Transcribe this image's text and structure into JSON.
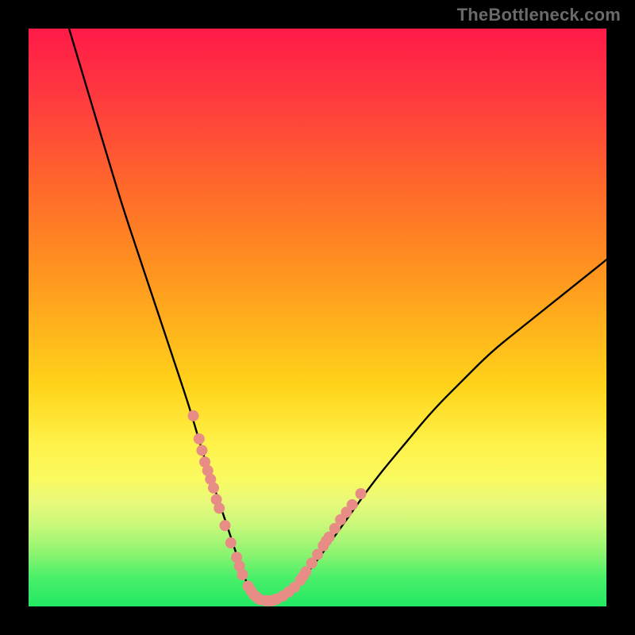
{
  "watermark": "TheBottleneck.com",
  "chart_data": {
    "type": "line",
    "title": "",
    "xlabel": "",
    "ylabel": "",
    "xlim": [
      0,
      100
    ],
    "ylim": [
      0,
      100
    ],
    "grid": false,
    "legend": false,
    "background_gradient": {
      "direction": "top-to-bottom",
      "stops": [
        {
          "pos": 0,
          "color": "#ff1a48"
        },
        {
          "pos": 12,
          "color": "#ff3a3f"
        },
        {
          "pos": 28,
          "color": "#ff6a2a"
        },
        {
          "pos": 44,
          "color": "#ff9a1e"
        },
        {
          "pos": 62,
          "color": "#ffd41a"
        },
        {
          "pos": 72,
          "color": "#fff24a"
        },
        {
          "pos": 78,
          "color": "#f9fa60"
        },
        {
          "pos": 82,
          "color": "#e8f97a"
        },
        {
          "pos": 86,
          "color": "#c8f879"
        },
        {
          "pos": 91,
          "color": "#8af470"
        },
        {
          "pos": 95,
          "color": "#4aef6a"
        },
        {
          "pos": 100,
          "color": "#22e863"
        }
      ]
    },
    "series": [
      {
        "name": "bottleneck-curve",
        "color": "#000000",
        "x": [
          7,
          10,
          13,
          16,
          19,
          22,
          25,
          28,
          30,
          32,
          34,
          35,
          36,
          37,
          38,
          39,
          40,
          42,
          44,
          46,
          50,
          55,
          60,
          65,
          70,
          75,
          80,
          85,
          90,
          95,
          100
        ],
        "y": [
          100,
          90,
          80,
          70,
          61,
          52,
          43,
          34,
          27,
          21,
          15,
          12,
          9,
          6,
          3.5,
          2,
          1.2,
          1,
          1.5,
          3,
          8,
          15,
          22,
          28,
          34,
          39,
          44,
          48,
          52,
          56,
          60
        ]
      }
    ],
    "points": {
      "name": "sample-dots",
      "color": "#e88d86",
      "radius_px": 7,
      "data": [
        {
          "x": 28.5,
          "y": 33
        },
        {
          "x": 29.5,
          "y": 29
        },
        {
          "x": 30,
          "y": 27
        },
        {
          "x": 30.5,
          "y": 25
        },
        {
          "x": 31,
          "y": 23.5
        },
        {
          "x": 31.5,
          "y": 22
        },
        {
          "x": 32,
          "y": 20.5
        },
        {
          "x": 32.5,
          "y": 18.5
        },
        {
          "x": 33,
          "y": 17
        },
        {
          "x": 34,
          "y": 14
        },
        {
          "x": 35,
          "y": 11
        },
        {
          "x": 36,
          "y": 8.5
        },
        {
          "x": 36.5,
          "y": 7
        },
        {
          "x": 37,
          "y": 5.5
        },
        {
          "x": 38,
          "y": 3.5
        },
        {
          "x": 38.5,
          "y": 2.7
        },
        {
          "x": 39,
          "y": 2
        },
        {
          "x": 39.5,
          "y": 1.6
        },
        {
          "x": 40,
          "y": 1.2
        },
        {
          "x": 41,
          "y": 1
        },
        {
          "x": 41.5,
          "y": 1
        },
        {
          "x": 42,
          "y": 1
        },
        {
          "x": 42.5,
          "y": 1.1
        },
        {
          "x": 43,
          "y": 1.3
        },
        {
          "x": 44,
          "y": 1.8
        },
        {
          "x": 45,
          "y": 2.5
        },
        {
          "x": 46,
          "y": 3.3
        },
        {
          "x": 47,
          "y": 4.5
        },
        {
          "x": 47.5,
          "y": 5.2
        },
        {
          "x": 48,
          "y": 6
        },
        {
          "x": 49,
          "y": 7.5
        },
        {
          "x": 50,
          "y": 9
        },
        {
          "x": 51,
          "y": 10.5
        },
        {
          "x": 51.5,
          "y": 11.3
        },
        {
          "x": 52,
          "y": 12
        },
        {
          "x": 53,
          "y": 13.5
        },
        {
          "x": 54,
          "y": 15
        },
        {
          "x": 55,
          "y": 16.3
        },
        {
          "x": 56,
          "y": 17.6
        },
        {
          "x": 57.5,
          "y": 19.5
        }
      ]
    }
  }
}
